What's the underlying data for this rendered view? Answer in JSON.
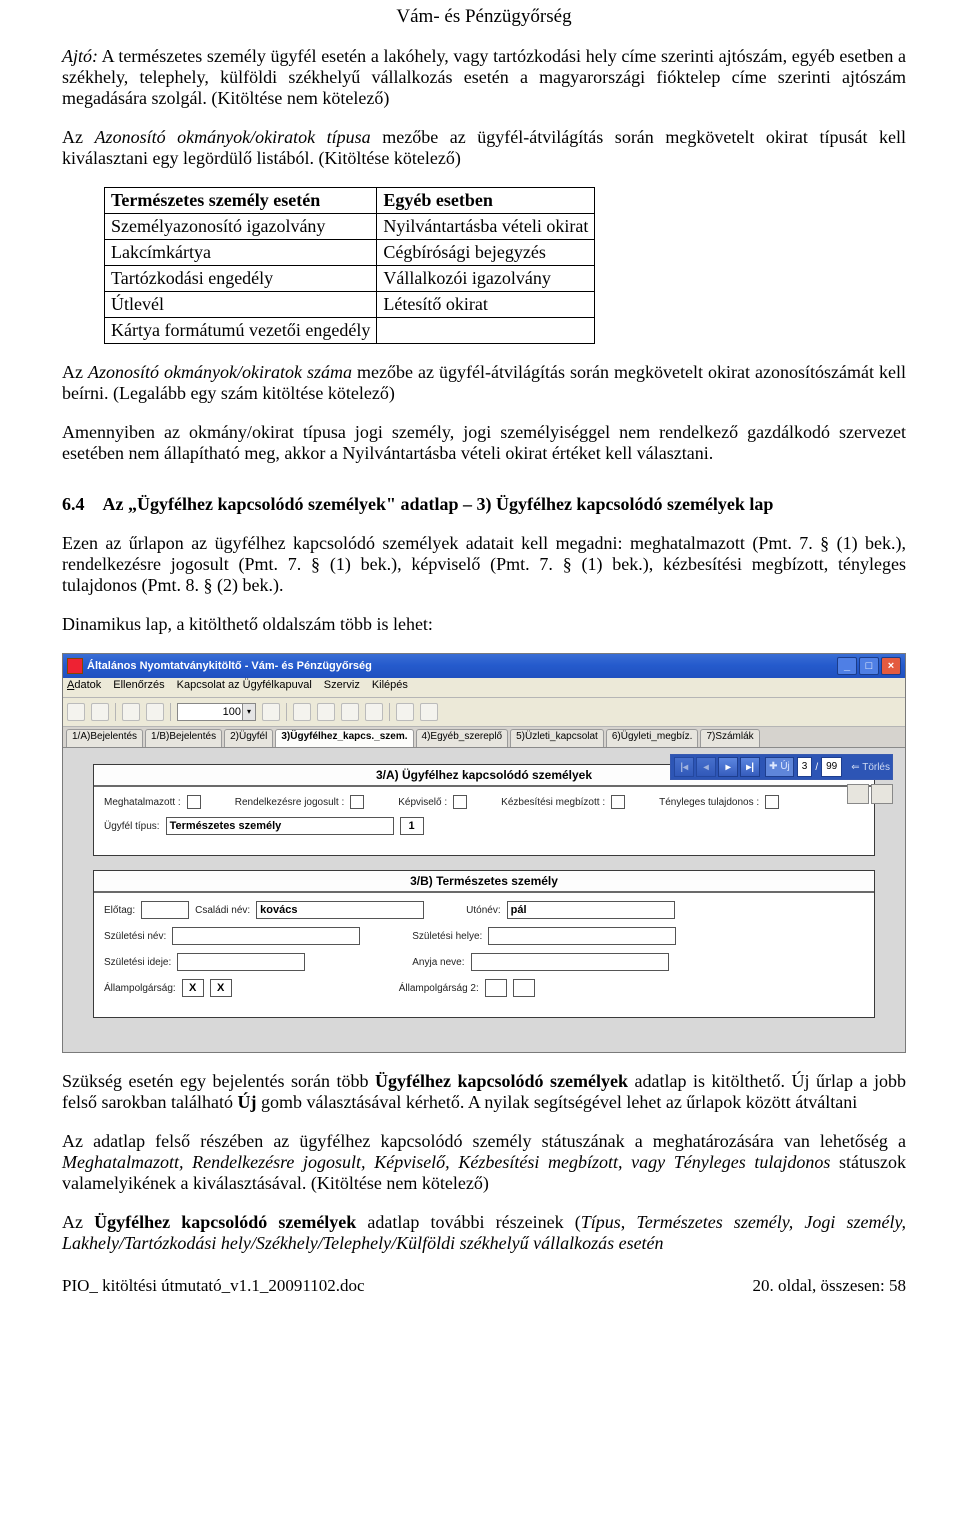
{
  "header": "Vám- és Pénzügyőrség",
  "para1_label": "Ajtó:",
  "para1_rest": " A természetes személy ügyfél esetén a lakóhely, vagy tartózkodási hely címe szerinti ajtószám, egyéb esetben a székhely, telephely, külföldi székhelyű vállalkozás esetén a magyarországi fióktelep címe szerinti ajtószám megadására szolgál. (Kitöltése nem kötelező)",
  "para2_start": "Az ",
  "para2_em": "Azonosító okmányok/okiratok típusa",
  "para2_rest": " mezőbe az ügyfél-átvilágítás során megkövetelt okirat típusát kell kiválasztani egy legördülő listából. (Kitöltése kötelező)",
  "tbl": {
    "h1": "Természetes személy esetén",
    "h2": "Egyéb esetben",
    "rows": [
      [
        "Személyazonosító igazolvány",
        "Nyilvántartásba vételi okirat"
      ],
      [
        "Lakcímkártya",
        "Cégbírósági bejegyzés"
      ],
      [
        "Tartózkodási engedély",
        "Vállalkozói igazolvány"
      ],
      [
        "Útlevél",
        "Létesítő okirat"
      ],
      [
        "Kártya formátumú vezetői engedély",
        ""
      ]
    ]
  },
  "para3_start": "Az ",
  "para3_em": "Azonosító okmányok/okiratok száma",
  "para3_rest": " mezőbe az ügyfél-átvilágítás során megkövetelt okirat azonosítószámát kell beírni. (Legalább egy szám kitöltése kötelező)",
  "para4": "Amennyiben az okmány/okirat típusa jogi személy, jogi személyiséggel nem rendelkező gazdálkodó szervezet esetében nem állapítható meg, akkor a Nyilvántartásba vételi okirat értéket kell választani.",
  "sect_no": "6.4",
  "sect_title": "Az „Ügyfélhez kapcsolódó személyek\" adatlap – 3) Ügyfélhez kapcsolódó személyek lap",
  "para5": "Ezen az űrlapon az ügyfélhez kapcsolódó személyek adatait kell megadni: meghatalmazott (Pmt. 7. § (1) bek.), rendelkezésre jogosult (Pmt. 7. § (1) bek.), képviselő (Pmt. 7. § (1) bek.), kézbesítési megbízott, tényleges tulajdonos (Pmt. 8. § (2) bek.).",
  "para6": "Dinamikus lap, a kitölthető oldalszám több is lehet:",
  "app": {
    "title": "Általános Nyomtatványkitöltő - Vám- és Pénzügyőrség",
    "menu": [
      "Adatok",
      "Ellenőrzés",
      "Kapcsolat az Ügyfélkapuval",
      "Szerviz",
      "Kilépés"
    ],
    "zoom": "100",
    "tabs": [
      "1/A)Bejelentés",
      "1/B)Bejelentés",
      "2)Ügyfél",
      "3)Ügyfélhez_kapcs._szem.",
      "4)Egyéb_szereplő",
      "5)Üzleti_kapcsolat",
      "6)Ügyleti_megbíz.",
      "7)Számlák"
    ],
    "active_tab": 3,
    "pager": {
      "pos": "3",
      "of": "99",
      "delete": "⇐ Törlés"
    },
    "panelA": {
      "title": "3/A) Ügyfélhez kapcsolódó személyek",
      "labels": {
        "megh": "Meghatalmazott :",
        "rend": "Rendelkezésre jogosult :",
        "kepv": "Képviselő :",
        "kezb": "Kézbesítési megbízott :",
        "teny": "Tényleges tulajdonos :",
        "tipus": "Ügyfél típus:"
      },
      "tipus_value": "Természetes személy",
      "tipus_code": "1"
    },
    "panelB": {
      "title": "3/B) Természetes személy",
      "labels": {
        "elotag": "Előtag:",
        "csaladi": "Családi név:",
        "utonev": "Utónév:",
        "szulnev": "Születési név:",
        "szulhely": "Születési helye:",
        "szulido": "Születési ideje:",
        "anyja": "Anyja neve:",
        "allam1": "Állampolgárság:",
        "allam2": "Állampolgárság 2:"
      },
      "csaladi_value": "kovács",
      "utonev_value": "pál",
      "allam_code": "X"
    }
  },
  "para7_a": "Szükség esetén egy bejelentés során több ",
  "para7_b": "Ügyfélhez kapcsolódó személyek",
  "para7_c": " adatlap is kitölthető. Új űrlap a jobb felső sarokban található ",
  "para7_d": "Új",
  "para7_e": " gomb választásával kérhető. A nyilak segítségével lehet az űrlapok között átváltani",
  "para8_a": "Az adatlap felső részében az ügyfélhez kapcsolódó személy státuszának a meghatározására van lehetőség a ",
  "para8_b": "Meghatalmazott, Rendelkezésre jogosult, Képviselő, Kézbesítési megbízott, vagy Tényleges tulajdonos",
  "para8_c": " státuszok valamelyikének a kiválasztásával. (Kitöltése nem kötelező)",
  "para9_a": "Az ",
  "para9_b": "Ügyfélhez kapcsolódó személyek",
  "para9_c": " adatlap további részeinek (",
  "para9_d": "Típus",
  "para9_e": ", ",
  "para9_f": "Természetes személy, Jogi személy, Lakhely/Tartózkodási hely/Székhely/Telephely/Külföldi székhelyű vállalkozás esetén",
  "footer_left": "PIO_ kitöltési útmutató_v1.1_20091102.doc",
  "footer_right": "20. oldal, összesen: 58"
}
